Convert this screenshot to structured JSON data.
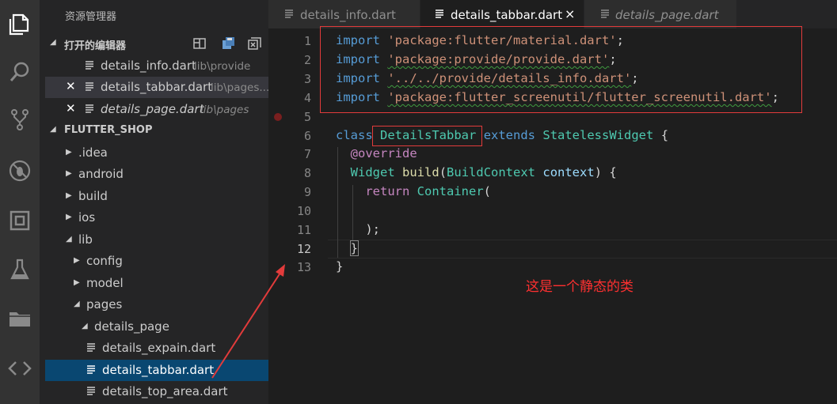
{
  "sidebar": {
    "title": "资源管理器",
    "open_editors": {
      "label": "打开的编辑器",
      "files": [
        {
          "name": "details_info.dart",
          "path": "lib\\provide"
        },
        {
          "name": "details_tabbar.dart",
          "path": "lib\\pages..."
        },
        {
          "name": "details_page.dart",
          "path": "lib\\pages"
        }
      ]
    },
    "project": {
      "label": "FLUTTER_SHOP",
      "tree": [
        {
          "name": ".idea"
        },
        {
          "name": "android"
        },
        {
          "name": "build"
        },
        {
          "name": "ios"
        },
        {
          "name": "lib"
        },
        {
          "name": "config"
        },
        {
          "name": "model"
        },
        {
          "name": "pages"
        },
        {
          "name": "details_page"
        },
        {
          "name": "details_expain.dart"
        },
        {
          "name": "details_tabbar.dart"
        },
        {
          "name": "details_top_area.dart"
        }
      ]
    }
  },
  "tabs": [
    {
      "label": "details_info.dart"
    },
    {
      "label": "details_tabbar.dart",
      "close": "×"
    },
    {
      "label": "details_page.dart"
    }
  ],
  "editor": {
    "line_numbers": [
      "1",
      "2",
      "3",
      "4",
      "5",
      "6",
      "7",
      "8",
      "9",
      "10",
      "11",
      "12",
      "13"
    ],
    "code": {
      "l1_kw": "import",
      "l1_str": "'package:flutter/material.dart'",
      "l1_end": ";",
      "l2_kw": "import",
      "l2_str": "'package:provide/provide.dart'",
      "l2_end": ";",
      "l3_kw": "import",
      "l3_str": "'../../provide/details_info.dart'",
      "l3_end": ";",
      "l4_kw": "import",
      "l4_str": "'package:flutter_screenutil/flutter_screenutil.dart'",
      "l4_end": ";",
      "l6_class": "class",
      "l6_name": "DetailsTabbar",
      "l6_extends": "extends",
      "l6_super": "StatelessWidget",
      "l6_brace": "{",
      "l7": "@override",
      "l8_type": "Widget",
      "l8_fn": "build",
      "l8_p1": "(",
      "l8_ptype": "BuildContext",
      "l8_pname": "context",
      "l8_end": ") {",
      "l9_ret": "return",
      "l9_type": "Container",
      "l9_end": "(",
      "l11": ");",
      "l12": "}",
      "l13": "}"
    },
    "annotation": "这是一个静态的类"
  },
  "colors": {
    "accent": "#094771",
    "annotation": "#ff3030"
  }
}
